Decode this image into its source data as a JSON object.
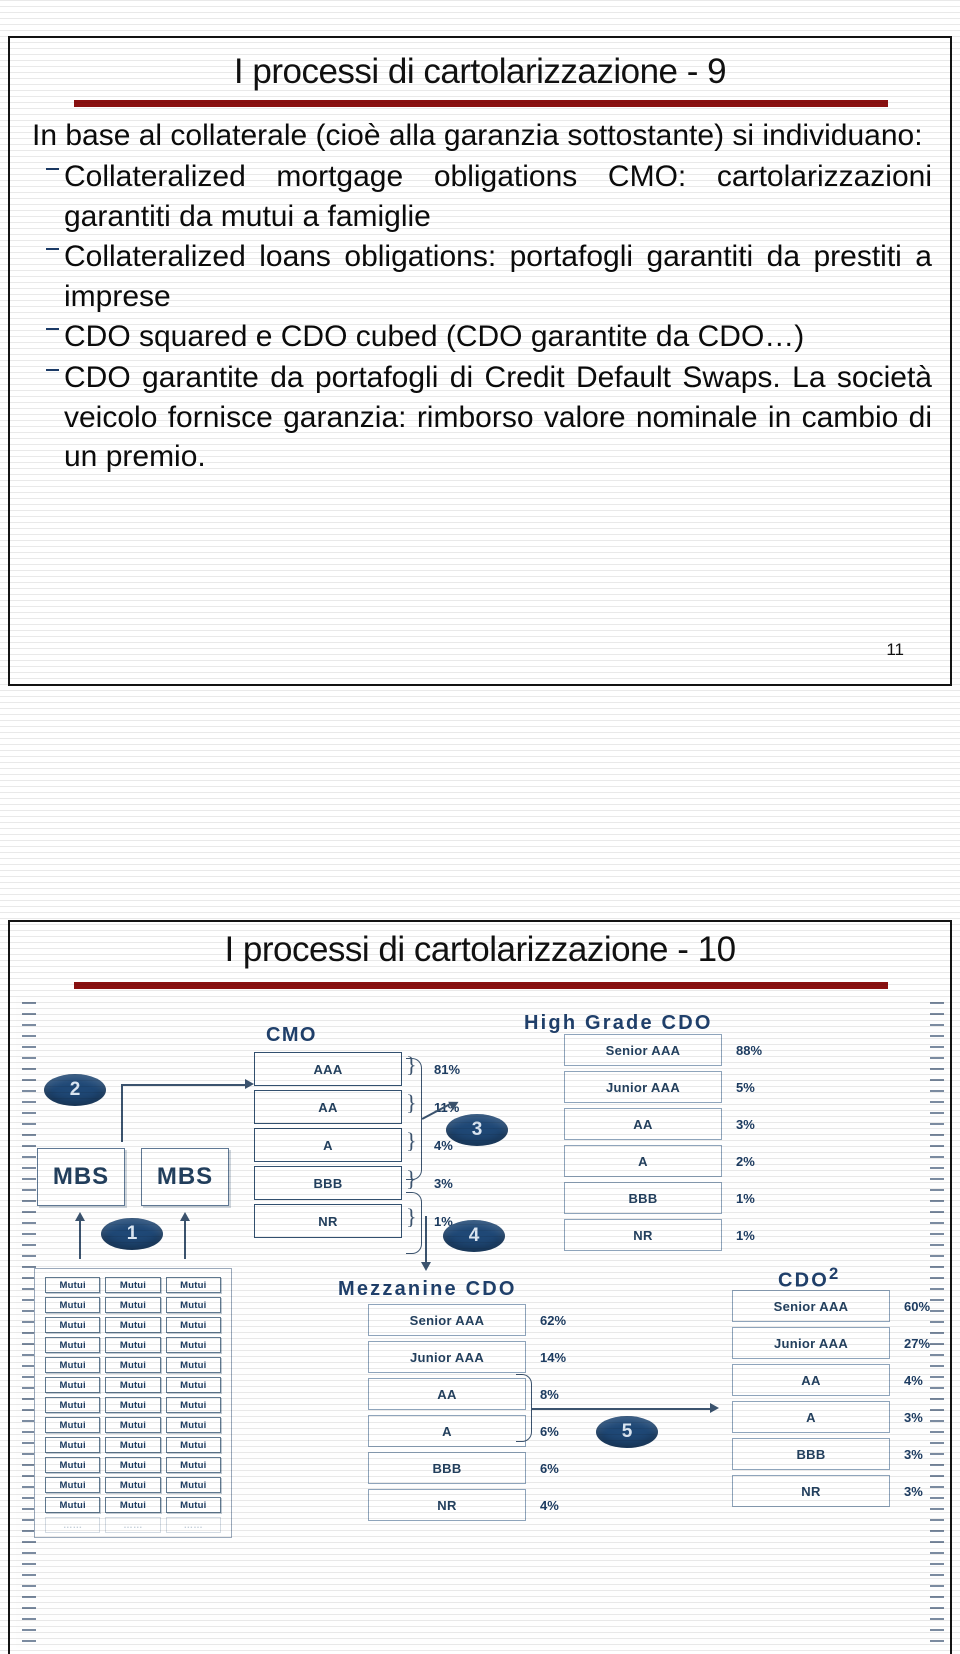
{
  "slide1": {
    "title": "I processi di cartolarizzazione - 9",
    "lead": "In base al collaterale (cioè alla garanzia sottostante) si individuano:",
    "bullets": [
      "Collateralized mortgage obligations CMO: cartolarizzazioni garantiti da mutui a famiglie",
      "Collateralized loans obligations: portafogli garantiti da prestiti a imprese",
      "CDO squared e CDO cubed (CDO garantite da CDO…)",
      "CDO garantite da portafogli di Credit Default Swaps. La società veicolo fornisce garanzia: rimborso valore nominale in cambio di un premio."
    ],
    "page_number": "11"
  },
  "slide2": {
    "title": "I processi di cartolarizzazione - 10"
  },
  "chart_data": {
    "type": "diagram",
    "title": "I processi di cartolarizzazione - 10",
    "description": "Securitization waterfall: mortgage pool to MBS to CMO to High Grade CDO / Mezzanine CDO to CDO squared",
    "step_badges": [
      "1",
      "2",
      "3",
      "4",
      "5"
    ],
    "pool": {
      "label": "Mutui",
      "columns": 3,
      "rows": 13,
      "last_row_faded": true
    },
    "mbs_boxes": [
      "MBS",
      "MBS"
    ],
    "columns": [
      {
        "name": "CMO",
        "header": "CMO",
        "tranches": [
          {
            "label": "AAA",
            "pct": "81%"
          },
          {
            "label": "AA",
            "pct": "11%"
          },
          {
            "label": "A",
            "pct": "4%"
          },
          {
            "label": "BBB",
            "pct": "3%"
          },
          {
            "label": "NR",
            "pct": "1%"
          }
        ]
      },
      {
        "name": "High Grade CDO",
        "header": "High Grade  CDO",
        "tranches": [
          {
            "label": "Senior AAA",
            "pct": "88%"
          },
          {
            "label": "Junior AAA",
            "pct": "5%"
          },
          {
            "label": "AA",
            "pct": "3%"
          },
          {
            "label": "A",
            "pct": "2%"
          },
          {
            "label": "BBB",
            "pct": "1%"
          },
          {
            "label": "NR",
            "pct": "1%"
          }
        ]
      },
      {
        "name": "Mezzanine CDO",
        "header": "Mezzanine  CDO",
        "tranches": [
          {
            "label": "Senior AAA",
            "pct": "62%"
          },
          {
            "label": "Junior AAA",
            "pct": "14%"
          },
          {
            "label": "AA",
            "pct": "8%"
          },
          {
            "label": "A",
            "pct": "6%"
          },
          {
            "label": "BBB",
            "pct": "6%"
          },
          {
            "label": "NR",
            "pct": "4%"
          }
        ]
      },
      {
        "name": "CDO squared",
        "header": "CDO²",
        "tranches": [
          {
            "label": "Senior AAA",
            "pct": "60%"
          },
          {
            "label": "Junior AAA",
            "pct": "27%"
          },
          {
            "label": "AA",
            "pct": "4%"
          },
          {
            "label": "A",
            "pct": "3%"
          },
          {
            "label": "BBB",
            "pct": "3%"
          },
          {
            "label": "NR",
            "pct": "3%"
          }
        ]
      }
    ],
    "colors": {
      "badge": "#1f4876",
      "box_border": "#32506f",
      "text": "#1d3c61",
      "title_rule": "#8a1111"
    }
  }
}
